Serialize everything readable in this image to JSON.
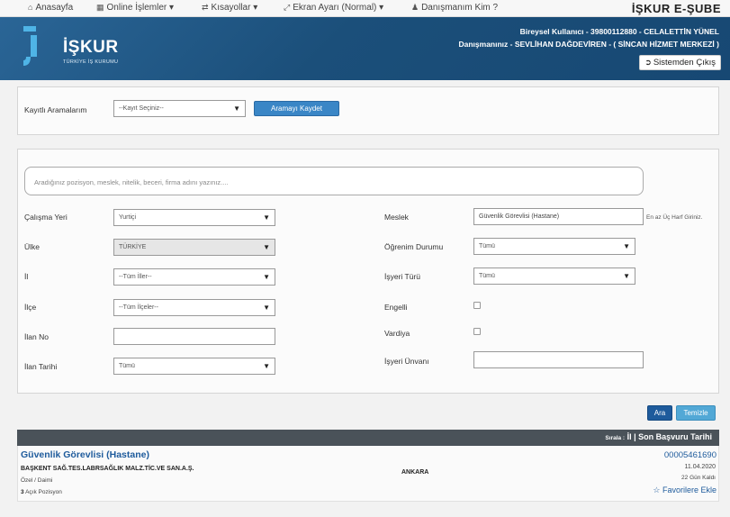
{
  "topnav": {
    "home": "Anasayfa",
    "online": "Online İşlemler",
    "shortcuts": "Kısayollar",
    "screen": "Ekran Ayarı (Normal)",
    "advisor": "Danışmanım Kim ?",
    "brand": "İŞKUR E-ŞUBE"
  },
  "header": {
    "logo_text": "İŞKUR",
    "logo_sub": "TÜRKİYE İŞ KURUMU",
    "user_line": "Bireysel Kullanıcı - 39800112880 - CELALETTİN YÜNEL",
    "advisor_line": "Danışmanınız - SEVLİHAN DAĞDEVİREN - ( SİNCAN HİZMET MERKEZİ )",
    "logout": "Sistemden Çıkış"
  },
  "saved_search": {
    "label": "Kayıtlı Aramalarım",
    "select_value": "--Kayıt Seçiniz--",
    "save_button": "Aramayı Kaydet"
  },
  "filters": {
    "search_placeholder": "Aradığınız pozisyon, meslek, nitelik, beceri, firma adını yazınız....",
    "work_place_label": "Çalışma Yeri",
    "work_place_value": "Yurtiçi",
    "country_label": "Ülke",
    "country_value": "TÜRKİYE",
    "province_label": "İl",
    "province_value": "--Tüm İller--",
    "district_label": "İlçe",
    "district_value": "--Tüm İlçeler--",
    "ad_no_label": "İlan No",
    "ad_no_value": "",
    "ad_date_label": "İlan Tarihi",
    "ad_date_value": "Tümü",
    "profession_label": "Meslek",
    "profession_value": "Güvenlik Görevlisi (Hastane)",
    "profession_hint": "En az Üç Harf Giriniz.",
    "education_label": "Öğrenim Durumu",
    "education_value": "Tümü",
    "employer_type_label": "İşyeri Türü",
    "employer_type_value": "Tümü",
    "disabled_label": "Engelli",
    "shift_label": "Vardiya",
    "employer_title_label": "İşyeri Ünvanı",
    "employer_title_value": ""
  },
  "actions": {
    "search": "Ara",
    "clear": "Temizle"
  },
  "results": {
    "sort_prefix": "Sırala :",
    "sort_text": "İl | Son Başvuru Tarihi",
    "items": [
      {
        "title": "Güvenlik Görevlisi (Hastane)",
        "company": "BAŞKENT SAĞ.TES.LABRSAĞLIK MALZ.TİC.VE SAN.A.Ş.",
        "type": "Özel / Daimi",
        "positions_count": "3",
        "positions_text": "Açık Pozisyon",
        "city": "ANKARA",
        "ad_no": "00005461690",
        "date": "11.04.2020",
        "days_left": "22 Gün Kaldı",
        "favorite": "Favorilere Ekle"
      }
    ]
  }
}
